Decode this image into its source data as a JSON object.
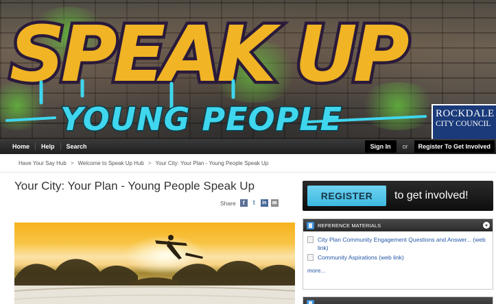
{
  "banner": {
    "speak_up": "SPEAK UP",
    "young_people": "YOUNG PEOPLE",
    "council": {
      "line1": "ROCKDALE",
      "line2": "CITY COUNCIL"
    }
  },
  "nav": {
    "links": [
      "Home",
      "Help",
      "Search"
    ],
    "sign_in": "Sign In",
    "or": "or",
    "register": "Register To Get Involved"
  },
  "breadcrumb": [
    "Have Your Say Hub",
    "Welcome to Speak Up Hub",
    "Your City: Your Plan - Young People Speak Up"
  ],
  "breadcrumb_separator": ">",
  "main": {
    "title": "Your City: Your Plan - Young People Speak Up",
    "share_label": "Share"
  },
  "sidebar": {
    "register_button": "REGISTER",
    "register_tagline": "to get involved!",
    "reference_panel": {
      "title": "REFERENCE MATERIALS",
      "items": [
        "City Plan Community Engagement Questions and Answer... (web link)",
        "Community Aspirations (web link)"
      ],
      "more": "more..."
    }
  },
  "colors": {
    "nav_bg": "#1f1f1f",
    "accent_blue": "#3db8e0",
    "link": "#2356a5",
    "council_blue": "#1a3a7a"
  }
}
